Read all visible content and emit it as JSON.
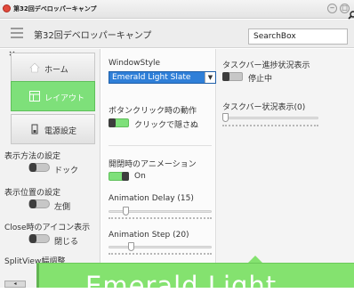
{
  "window": {
    "title": "第32回デベロッパーキャンプ",
    "controls": [
      "−",
      "□"
    ]
  },
  "header": {
    "title": "第32回デベロッパーキャンプ",
    "search": {
      "value": "SearchBox"
    }
  },
  "sidebar": {
    "nav": [
      {
        "label": "ホーム",
        "icon": "home-icon",
        "active": false
      },
      {
        "label": "レイアウト",
        "icon": "layout-icon",
        "active": true
      },
      {
        "label": "電源設定",
        "icon": "power-icon",
        "active": false
      }
    ],
    "settings": [
      {
        "label": "表示方法の設定",
        "value": "ドック"
      },
      {
        "label": "表示位置の設定",
        "value": "左側"
      },
      {
        "label": "Close時のアイコン表示",
        "value": "閉じる"
      },
      {
        "label": "SplitView幅調整"
      }
    ]
  },
  "panel_left": {
    "window_style": {
      "label": "WindowStyle",
      "selected": "Emerald Light Slate"
    },
    "click_action": {
      "label": "ボタンクリック時の動作",
      "value": "クリックで隠さぬ"
    },
    "animation": {
      "label": "開閉時のアニメーション",
      "value": "On"
    },
    "delay": {
      "label": "Animation Delay (15)",
      "level": 0.15
    },
    "step": {
      "label": "Animation Step (20)",
      "level": 0.2
    }
  },
  "panel_right": {
    "taskbar_progress": {
      "label": "タスクバー進捗状況表示",
      "value": "停止中"
    },
    "taskbar_state": {
      "label": "タスクバー状況表示(0)",
      "level": 0.0
    }
  },
  "overlay": {
    "text": "Emerald Light"
  },
  "colors": {
    "accent": "#7ee07a",
    "selection": "#2f7fd8",
    "app_icon": "#e14a3c"
  }
}
